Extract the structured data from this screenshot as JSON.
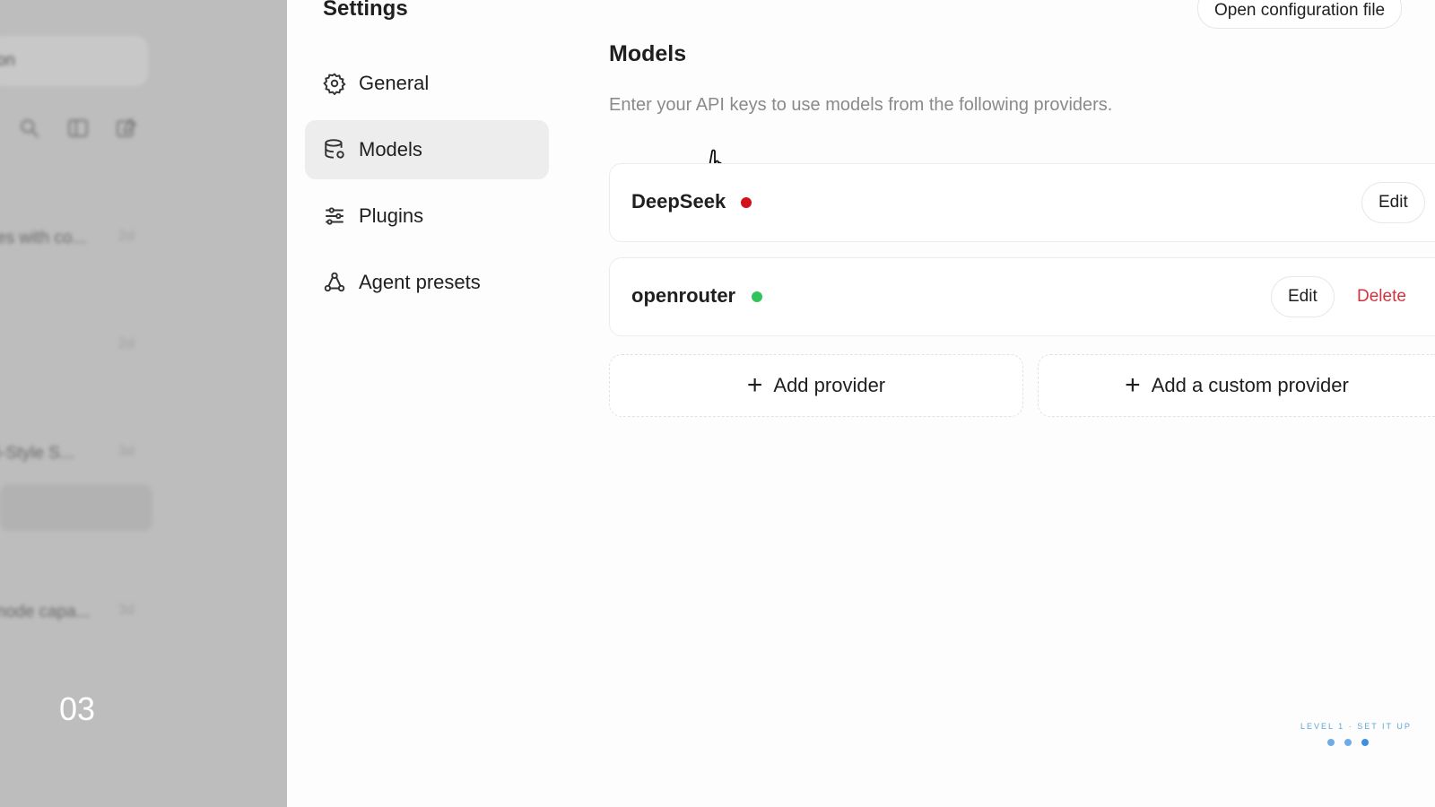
{
  "background_app": {
    "session_button": "sion",
    "rows": [
      {
        "title": "es with co...",
        "date": "2d"
      },
      {
        "title": "",
        "date": "2d"
      },
      {
        "title": "i-Style S...",
        "date": "3d"
      },
      {
        "title": "node capa...",
        "date": "3d"
      }
    ],
    "page_number": "03"
  },
  "settings": {
    "title": "Settings",
    "open_config_label": "Open configuration file",
    "nav": [
      {
        "label": "General",
        "icon": "gear-icon",
        "active": false
      },
      {
        "label": "Models",
        "icon": "database-icon",
        "active": true
      },
      {
        "label": "Plugins",
        "icon": "sliders-icon",
        "active": false
      },
      {
        "label": "Agent presets",
        "icon": "agent-icon",
        "active": false
      }
    ]
  },
  "models": {
    "title": "Models",
    "description": "Enter your API keys to use models from the following providers.",
    "providers": [
      {
        "name": "DeepSeek",
        "status_color": "#d0121e",
        "edit_label": "Edit"
      },
      {
        "name": "openrouter",
        "status_color": "#32c45a",
        "edit_label": "Edit",
        "delete_label": "Delete"
      }
    ],
    "add_provider_label": "Add provider",
    "add_custom_provider_label": "Add a custom provider"
  },
  "footer": {
    "level_label": "LEVEL 1 · SET IT UP"
  },
  "colors": {
    "delete_red": "#d0343f",
    "nav_active_bg": "#ededed",
    "progress_blue": "#3f8fe0"
  }
}
